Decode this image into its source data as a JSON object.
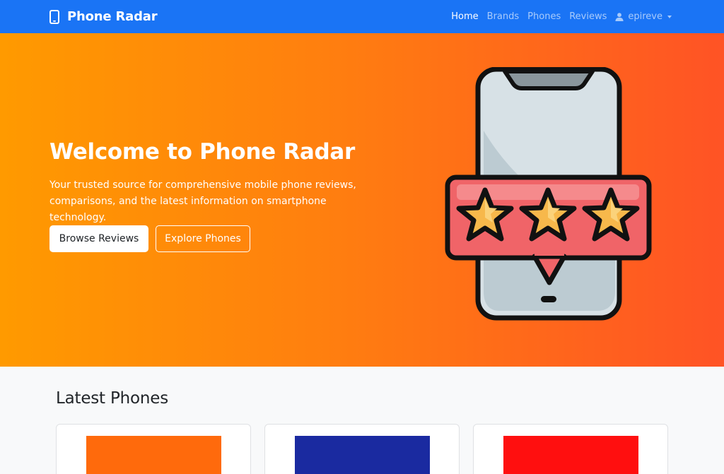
{
  "navbar": {
    "brand": "Phone Radar",
    "brand_icon": "mobile-phone-icon",
    "links": [
      "Home",
      "Brands",
      "Phones",
      "Reviews"
    ],
    "active": "Home",
    "user": "epireve",
    "user_icon": "user-icon",
    "color": "#1a74f5"
  },
  "hero": {
    "title": "Welcome to Phone Radar",
    "text": "Your trusted source for comprehensive mobile phone reviews, comparisons, and the latest information on smartphone technology.",
    "primary_button": "Browse Reviews",
    "secondary_button": "Explore Phones",
    "illustration": "phone-rating-stars-icon",
    "gradient": [
      "#ff9a00",
      "#ff5325"
    ]
  },
  "latest": {
    "title": "Latest Phones",
    "cards": [
      {
        "image_color": "#ff6a0c"
      },
      {
        "image_color": "#1a2aa0"
      },
      {
        "image_color": "#ff0f0f"
      }
    ]
  }
}
